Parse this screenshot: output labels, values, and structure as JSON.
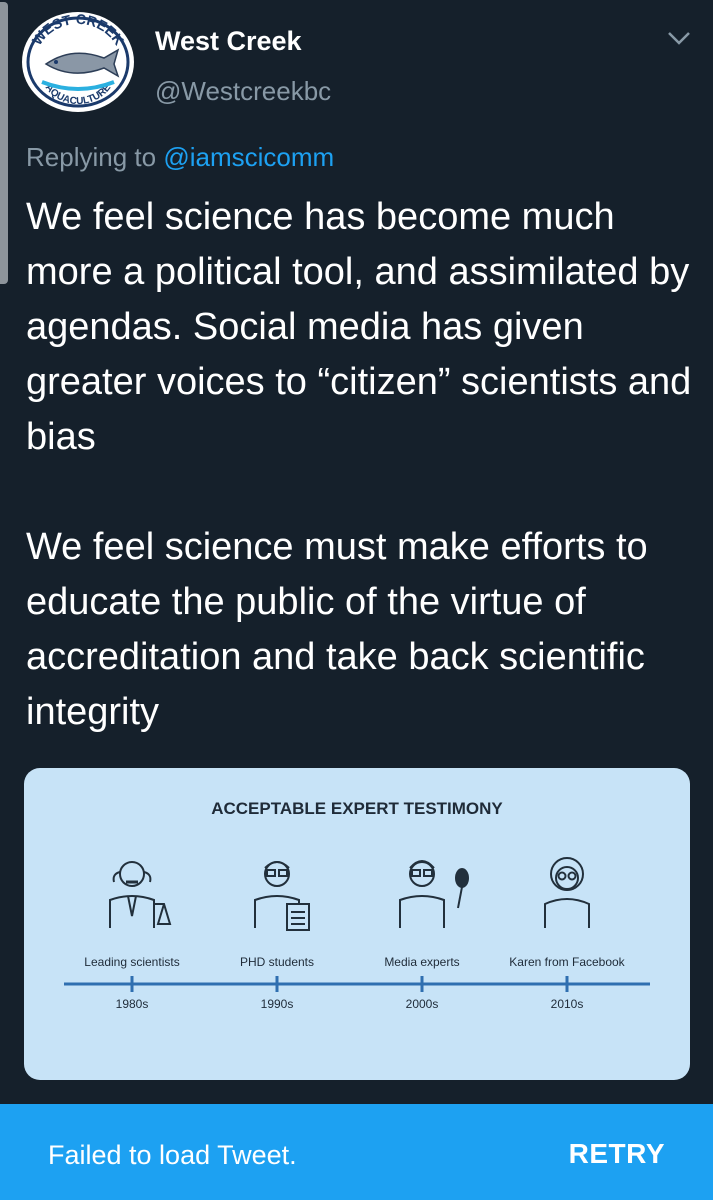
{
  "tweet": {
    "author_name": "West Creek",
    "author_handle": "@Westcreekbc",
    "reply_prefix": "Replying to",
    "reply_mention": "@iamscicomm",
    "paragraphs": [
      "We feel science has become much more a political tool, and assimilated by agendas. Social media has given greater voices to “citizen” scientists and bias",
      "We feel science must make efforts to educate the public of the virtue of accreditation and take back scientific integrity"
    ],
    "avatar_icon": "west-creek-aquaculture-logo",
    "avatar_logo_top": "WEST CREEK",
    "avatar_logo_bottom": "AQUACULTURE",
    "menu_icon": "chevron-down-icon"
  },
  "media_image": {
    "title": "ACCEPTABLE EXPERT TESTIMONY",
    "experts": [
      {
        "label": "Leading scientists",
        "decade": "1980s",
        "icon": "scientist-icon"
      },
      {
        "label": "PHD students",
        "decade": "1990s",
        "icon": "student-icon"
      },
      {
        "label": "Media experts",
        "decade": "2000s",
        "icon": "media-expert-icon"
      },
      {
        "label": "Karen from Facebook",
        "decade": "2010s",
        "icon": "karen-icon"
      }
    ]
  },
  "error_bar": {
    "message": "Failed to load Tweet.",
    "retry_label": "RETRY"
  },
  "colors": {
    "background": "#15202b",
    "secondary_text": "#8899a6",
    "link": "#1da1f2",
    "error_bar": "#1da1f2",
    "media_bg": "#c7e3f7"
  }
}
